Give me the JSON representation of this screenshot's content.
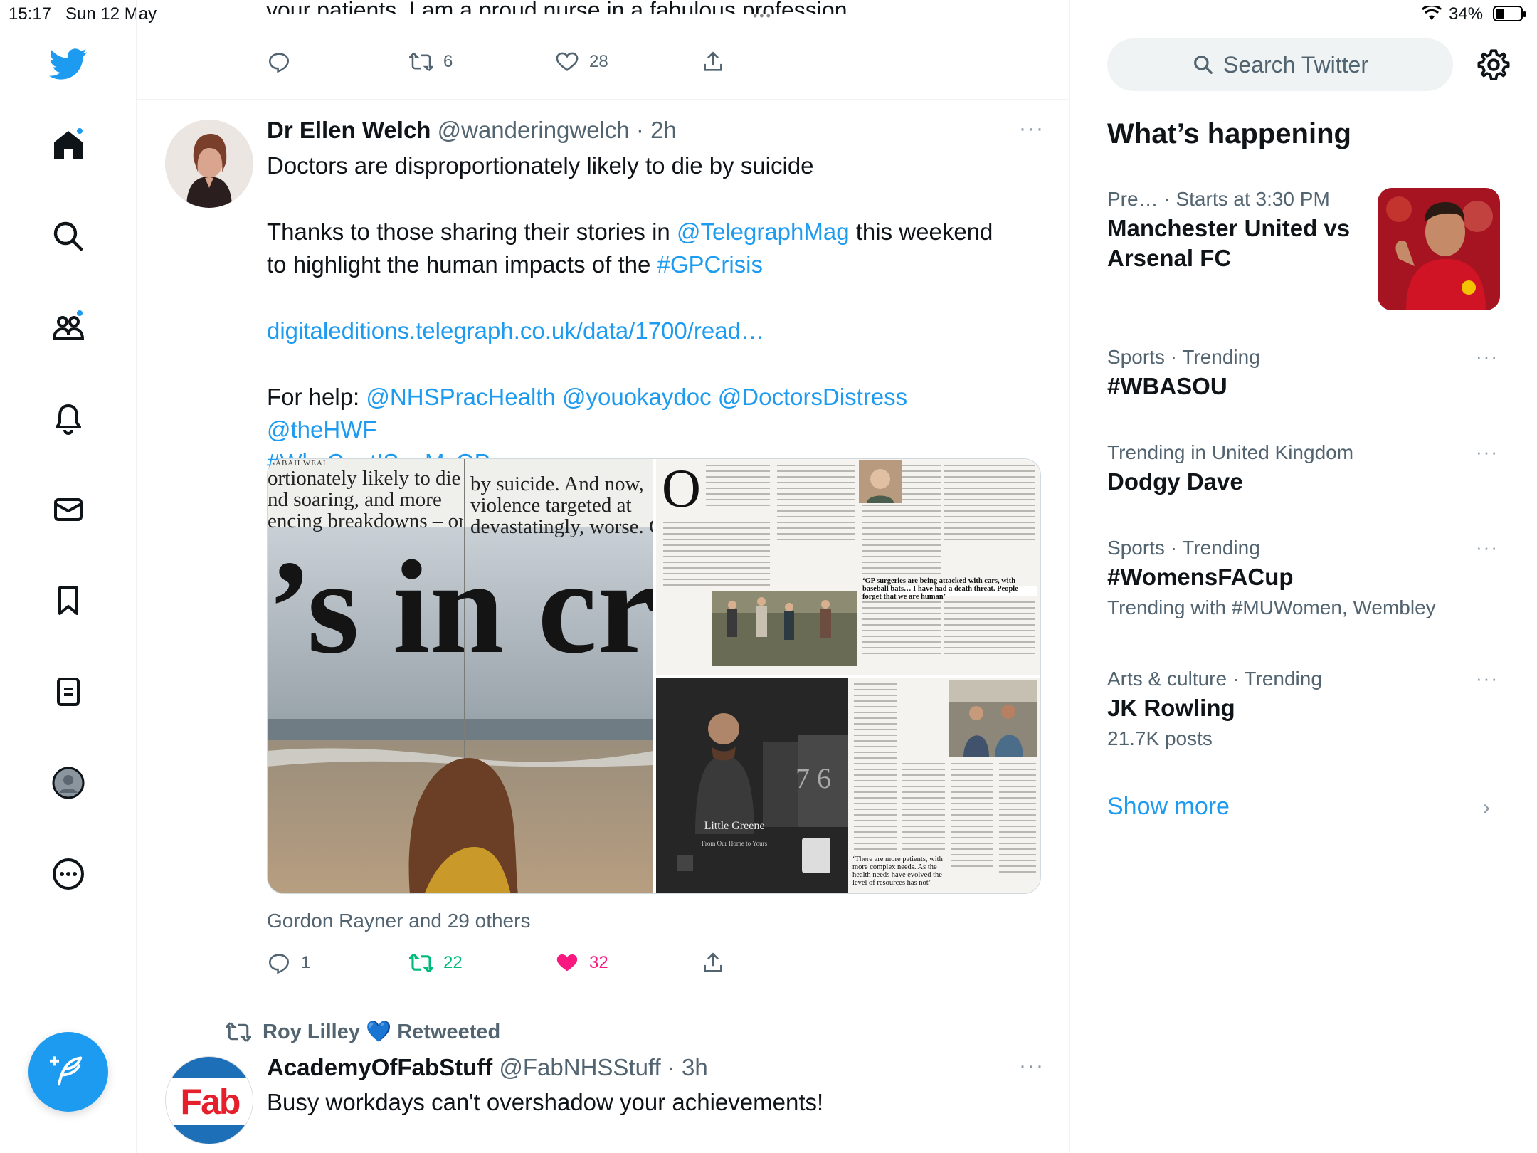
{
  "status_bar": {
    "time": "15:17",
    "date": "Sun 12 May",
    "battery": "34%"
  },
  "colors": {
    "accent": "#1d9bf0",
    "retweet_green": "#00ba7c",
    "like_pink": "#f91880"
  },
  "sidebar": {
    "items": [
      {
        "name": "twitter-logo",
        "icon": "bird-icon"
      },
      {
        "name": "home",
        "icon": "home-icon"
      },
      {
        "name": "explore",
        "icon": "search-icon"
      },
      {
        "name": "communities",
        "icon": "people-icon"
      },
      {
        "name": "notifications",
        "icon": "bell-icon"
      },
      {
        "name": "messages",
        "icon": "mail-icon"
      },
      {
        "name": "bookmarks",
        "icon": "bookmark-icon"
      },
      {
        "name": "lists",
        "icon": "list-icon"
      },
      {
        "name": "profile",
        "icon": "profile-icon"
      },
      {
        "name": "more",
        "icon": "more-icon"
      }
    ]
  },
  "prev_tweet": {
    "partial_text": "your patients. I am a proud nurse in a fabulous profession.",
    "retweets": "6",
    "likes": "28"
  },
  "tweet": {
    "name": "Dr Ellen Welch",
    "handle": "@wanderingwelch",
    "time": "2h",
    "line1": "Doctors are disproportionately likely to die by suicide",
    "line2a": "Thanks to those sharing their stories in ",
    "mention1": "@TelegraphMag",
    "line2b": " this weekend",
    "line3a": "to highlight the human impacts of the ",
    "hashtag1": "#GPCrisis",
    "url": "digitaleditions.telegraph.co.uk/data/1700/read…",
    "help_prefix": "For help: ",
    "help_mentions": "@NHSPracHealth @youokaydoc @DoctorsDistress @theHWF",
    "hashtag2": "#WhyCantISeeMyGP",
    "media": {
      "headline_line1": "ortionately likely to die",
      "headline_line2": "nd soaring, and more",
      "headline_line3": "encing breakdowns – or,",
      "headline_right1": "by suicide. And now,",
      "headline_right2": "violence targeted at",
      "headline_right3": "devastatingly, worse. G",
      "big_text": "’s in cri",
      "byline": "SABAH WEAL",
      "drop_cap": "O",
      "pullquote1": "‘GP surgeries are being attacked with cars, with baseball bats… I have had a death threat. People forget that we are human’",
      "pullquote2": "‘There are more patients, with more complex needs. As the health needs have evolved the level of resources has not’",
      "ad_brand": "Little Greene",
      "ad_line": "From Our Home to Yours",
      "ad_numbers": "7 6"
    },
    "liked_by": "Gordon Rayner and 29 others",
    "replies": "1",
    "retweets": "22",
    "likes": "32"
  },
  "next_tweet": {
    "retweeted_by": "Roy Lilley 💙 Retweeted",
    "name": "AcademyOfFabStuff",
    "handle": "@FabNHSStuff",
    "time": "3h",
    "text": "Busy workdays can't overshadow your achievements!",
    "avatar_text": "Fab"
  },
  "right": {
    "search_placeholder": "Search Twitter",
    "section_title": "What’s happening",
    "trends": [
      {
        "meta_a": "Pre…",
        "meta_b": " · Starts at 3:30 PM",
        "title": "Manchester United vs Arsenal FC",
        "sub": ""
      },
      {
        "meta": "Sports · Trending",
        "title": "#WBASOU",
        "sub": ""
      },
      {
        "meta": "Trending in United Kingdom",
        "title": "Dodgy Dave",
        "sub": ""
      },
      {
        "meta": "Sports · Trending",
        "title": "#WomensFACup",
        "sub": "Trending with #MUWomen, Wembley"
      },
      {
        "meta": "Arts & culture · Trending",
        "title": "JK Rowling",
        "sub": "21.7K posts"
      }
    ],
    "show_more": "Show more"
  }
}
